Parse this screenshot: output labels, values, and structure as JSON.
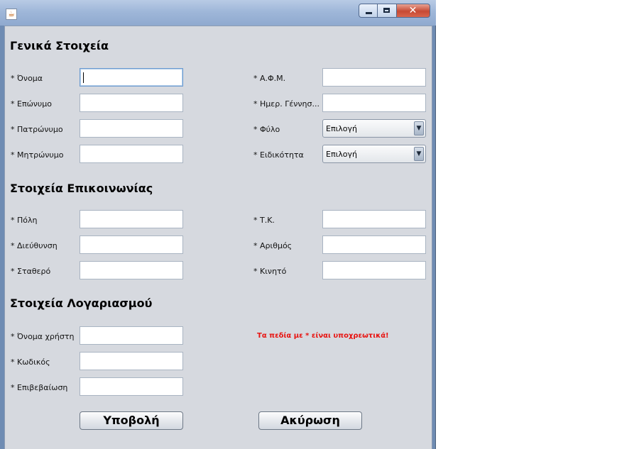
{
  "window": {
    "title": ""
  },
  "sections": {
    "general": "Γενικά Στοιχεία",
    "contact": "Στοιχεία Επικοινωνίας",
    "account": "Στοιχεία Λογαριασμού"
  },
  "fields": {
    "name": {
      "label": "* Όνομα",
      "value": ""
    },
    "surname": {
      "label": "* Επώνυμο",
      "value": ""
    },
    "father_name": {
      "label": "* Πατρώνυμο",
      "value": ""
    },
    "mother_name": {
      "label": "* Μητρώνυμο",
      "value": ""
    },
    "afm": {
      "label": "* Α.Φ.Μ.",
      "value": ""
    },
    "birth_date": {
      "label": "* Ημερ. Γέννησ...",
      "value": ""
    },
    "gender": {
      "label": "*  Φύλο",
      "value": "Επιλογή"
    },
    "specialty": {
      "label": "* Ειδικότητα",
      "value": "Επιλογή"
    },
    "city": {
      "label": "* Πόλη",
      "value": ""
    },
    "address": {
      "label": "* Διεύθυνση",
      "value": ""
    },
    "landline": {
      "label": "*  Σταθερό",
      "value": ""
    },
    "postal_code": {
      "label": "* Τ.Κ.",
      "value": ""
    },
    "number": {
      "label": "* Αριθμός",
      "value": ""
    },
    "mobile": {
      "label": "* Κινητό",
      "value": ""
    },
    "username": {
      "label": "* Όνομα χρήστη",
      "value": ""
    },
    "password": {
      "label": "* Κωδικός",
      "value": ""
    },
    "confirm": {
      "label": "* Επιβεβαίωση",
      "value": ""
    }
  },
  "required_note": "Τα πεδία με * είναι υποχρεωτικά!",
  "buttons": {
    "submit": "Υποβολή",
    "cancel": "Ακύρωση"
  },
  "colors": {
    "required_note": "#e8120f",
    "window_bg": "#d6d9df"
  }
}
